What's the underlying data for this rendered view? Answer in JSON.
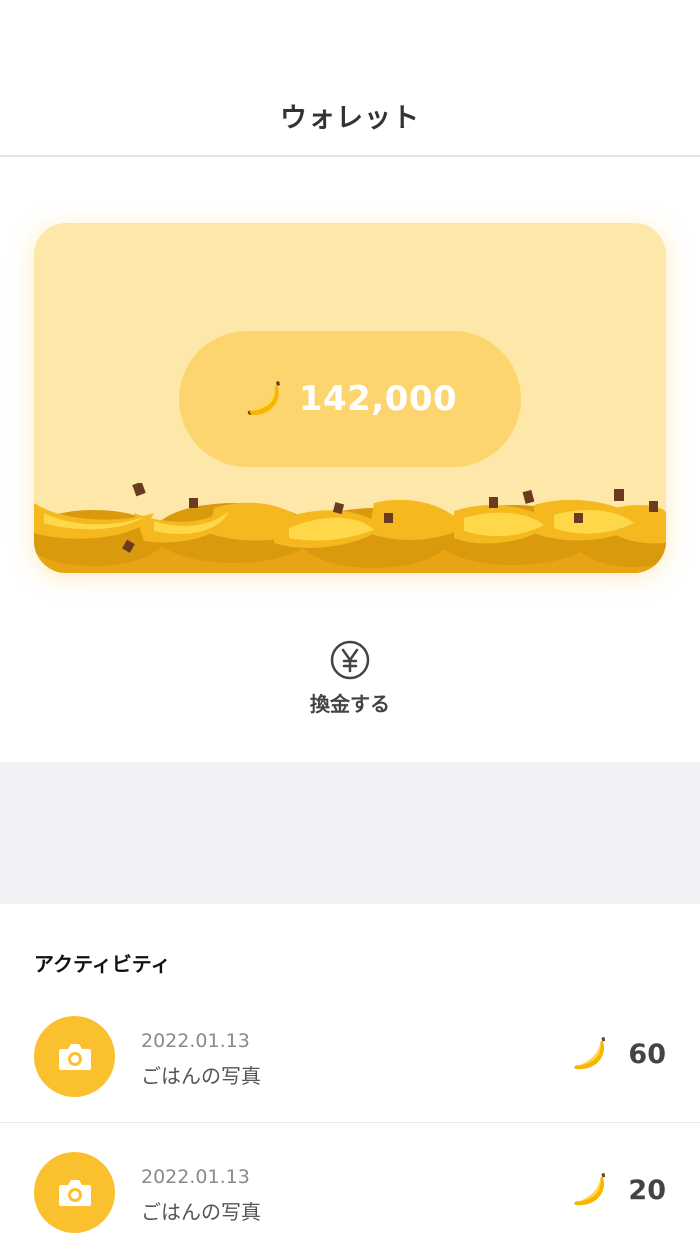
{
  "header": {
    "title": "ウォレット"
  },
  "wallet": {
    "balance": "142,000",
    "currency_icon": "banana-icon",
    "accent_color": "#fdd56f",
    "card_color": "#fde8a9"
  },
  "exchange": {
    "label": "換金する",
    "icon": "yen-circle-icon"
  },
  "activity": {
    "heading": "アクティビティ",
    "items": [
      {
        "date": "2022.01.13",
        "description": "ごはんの写真",
        "amount": "60",
        "icon": "camera-icon"
      },
      {
        "date": "2022.01.13",
        "description": "ごはんの写真",
        "amount": "20",
        "icon": "camera-icon"
      }
    ]
  }
}
